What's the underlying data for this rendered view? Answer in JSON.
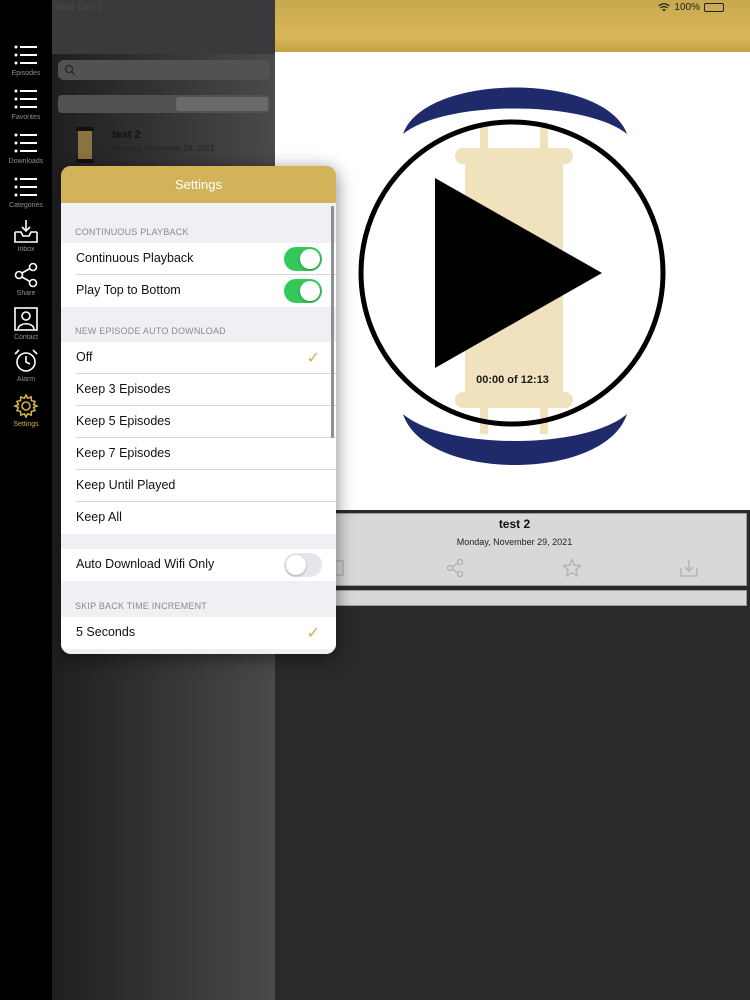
{
  "status_bar": {
    "time": "Wed Dec 1",
    "battery": "100%"
  },
  "colors": {
    "accent": "#d4b04a",
    "toggle_on": "#34c759",
    "header_gold": "#d3b35a",
    "navy": "#1f2a6b"
  },
  "tabbar": {
    "items": [
      {
        "label": "Episodes",
        "icon": "list-icon",
        "active": false
      },
      {
        "label": "Favorites",
        "icon": "list-icon",
        "active": false
      },
      {
        "label": "Downloads",
        "icon": "list-icon",
        "active": false
      },
      {
        "label": "Categories",
        "icon": "list-icon",
        "active": false
      },
      {
        "label": "Inbox",
        "icon": "inbox-icon",
        "active": false
      },
      {
        "label": "Share",
        "icon": "share-icon",
        "active": false
      },
      {
        "label": "Contact",
        "icon": "contact-icon",
        "active": false
      },
      {
        "label": "Alarm",
        "icon": "alarm-icon",
        "active": false
      },
      {
        "label": "Settings",
        "icon": "gear-icon",
        "active": true
      }
    ]
  },
  "episode_list": {
    "items": [
      {
        "title": "test 2",
        "date": "Monday, November 29, 2021"
      }
    ]
  },
  "player": {
    "time_display": "00:00 of 12:13",
    "title": "test 2",
    "date": "Monday, November 29, 2021"
  },
  "settings": {
    "title": "Settings",
    "sections": [
      {
        "header": "CONTINUOUS PLAYBACK",
        "rows": [
          {
            "label": "Continuous Playback",
            "control": "toggle",
            "on": true
          },
          {
            "label": "Play Top to Bottom",
            "control": "toggle",
            "on": true
          }
        ]
      },
      {
        "header": "NEW EPISODE AUTO DOWNLOAD",
        "rows": [
          {
            "label": "Off",
            "control": "check",
            "checked": true
          },
          {
            "label": "Keep 3 Episodes",
            "control": "check",
            "checked": false
          },
          {
            "label": "Keep 5 Episodes",
            "control": "check",
            "checked": false
          },
          {
            "label": "Keep 7 Episodes",
            "control": "check",
            "checked": false
          },
          {
            "label": "Keep Until Played",
            "control": "check",
            "checked": false
          },
          {
            "label": "Keep All",
            "control": "check",
            "checked": false
          }
        ]
      },
      {
        "header": "",
        "rows": [
          {
            "label": "Auto Download Wifi Only",
            "control": "toggle",
            "on": false
          }
        ]
      },
      {
        "header": "SKIP BACK TIME INCREMENT",
        "rows": [
          {
            "label": "5 Seconds",
            "control": "check",
            "checked": true
          }
        ]
      }
    ]
  }
}
